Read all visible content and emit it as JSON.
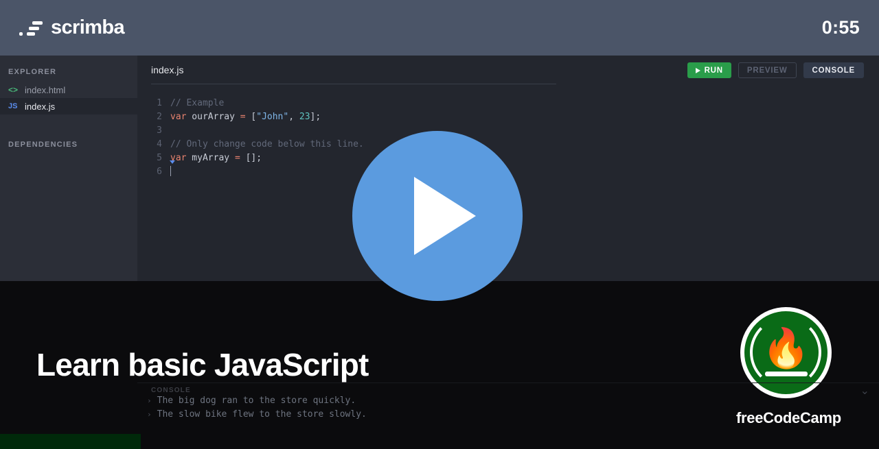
{
  "header": {
    "brand": "scrimba",
    "logo_icon": "scrimba-logo-icon",
    "timer": "0:55"
  },
  "sidebar": {
    "explorer_heading": "EXPLORER",
    "dependencies_heading": "DEPENDENCIES",
    "files": [
      {
        "name": "index.html",
        "icon": "html-file-icon",
        "icon_label": "<>",
        "selected": false
      },
      {
        "name": "index.js",
        "icon": "js-file-icon",
        "icon_label": "JS",
        "selected": true
      }
    ]
  },
  "editor": {
    "active_tab": "index.js",
    "toolbar": {
      "run_label": "RUN",
      "preview_label": "PREVIEW",
      "console_label": "CONSOLE"
    },
    "lines": [
      {
        "num": "1",
        "tokens": [
          {
            "t": "// Example",
            "c": "cmt"
          }
        ]
      },
      {
        "num": "2",
        "tokens": [
          {
            "t": "var",
            "c": "kw"
          },
          {
            "t": " ourArray ",
            "c": "pun"
          },
          {
            "t": "=",
            "c": "op"
          },
          {
            "t": " ",
            "c": "pun"
          },
          {
            "t": "[",
            "c": "pun"
          },
          {
            "t": "\"John\"",
            "c": "str"
          },
          {
            "t": ", ",
            "c": "pun"
          },
          {
            "t": "23",
            "c": "num"
          },
          {
            "t": "];",
            "c": "pun"
          }
        ]
      },
      {
        "num": "3",
        "tokens": []
      },
      {
        "num": "4",
        "tokens": [
          {
            "t": "// Only change code below this line.",
            "c": "cmt"
          }
        ]
      },
      {
        "num": "5",
        "tokens": [
          {
            "t": "var",
            "c": "kw"
          },
          {
            "t": " myArray ",
            "c": "pun"
          },
          {
            "t": "=",
            "c": "op"
          },
          {
            "t": " [];",
            "c": "pun"
          }
        ]
      },
      {
        "num": "6",
        "tokens": [],
        "caret": true
      }
    ]
  },
  "overlay": {
    "title": "Learn basic JavaScript",
    "play_button_icon": "play-icon",
    "logo": {
      "name": "freeCodeCamp",
      "flame_icon": "flame-icon",
      "accent_color": "#0a6b17"
    }
  },
  "console": {
    "label": "CONSOLE",
    "collapse_icon": "chevron-down-icon",
    "lines": [
      "The big dog ran to the store quickly.",
      "The slow bike flew to the store slowly."
    ]
  },
  "progress": {
    "fill_color": "#00290a",
    "percent": 16
  }
}
